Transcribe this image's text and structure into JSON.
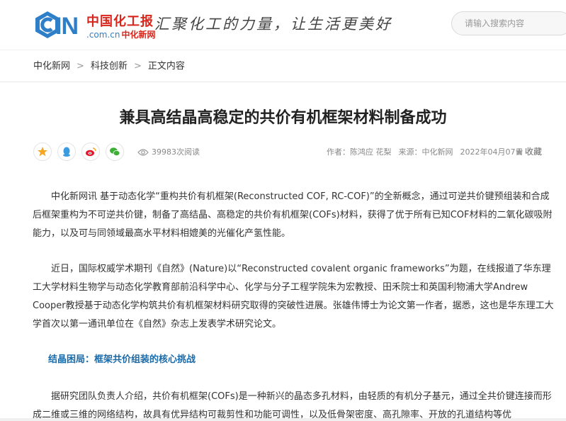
{
  "header": {
    "logo": {
      "cin": "IN",
      "cn_name": "中国化工报",
      "domain": ".com.cn",
      "site_name": "中化新网"
    },
    "slogan": "汇聚化工的力量，让生活更美好",
    "search": {
      "placeholder": "请输入搜索内容",
      "value": ""
    }
  },
  "breadcrumb": {
    "items": [
      "中化新网",
      "科技创新",
      "正文内容"
    ],
    "separator": ">"
  },
  "article": {
    "title": "兼具高结晶高稳定的共价有机框架材料制备成功",
    "share_icons": [
      "star-icon",
      "qq-icon",
      "weibo-icon",
      "wechat-icon"
    ],
    "views": "39983次阅读",
    "author": "作者：陈鸿应 花梨",
    "source": "来源：中化新网",
    "date": "2022年04月07日",
    "favorite": "收藏",
    "paragraphs": [
      "中化新网讯 基于动态化学“重构共价有机框架(Reconstructed COF, RC-COF)”的全新概念，通过可逆共价键预组装和合成后框架重构为不可逆共价键，制备了高结晶、高稳定的共价有机框架(COFs)材料，获得了优于所有已知COF材料的二氧化碳吸附能力，以及可与同领域最高水平材料相媲美的光催化产氢性能。",
      "近日，国际权威学术期刊《自然》(Nature)以“Reconstructed covalent organic frameworks”为题，在线报道了华东理工大学材料生物学与动态化学教育部前沿科学中心、化学与分子工程学院朱为宏教授、田禾院士和英国利物浦大学Andrew Cooper教授基于动态化学构筑共价有机框架材料研究取得的突破性进展。张雄伟博士为论文第一作者，据悉，这也是华东理工大学首次以第一通讯单位在《自然》杂志上发表学术研究论文。"
    ],
    "subheading": "结晶困局：框架共价组装的核心挑战",
    "paragraph3": "据研究团队负责人介绍，共价有机框架(COFs)是一种新兴的晶态多孔材料，由轻质的有机分子基元，通过全共价键连接而形成二维或三维的网络结构，故具有优异结构可裁剪性和功能可调性，以及低骨架密度、高孔隙率、开放的孔道结构等优"
  },
  "colors": {
    "brand_blue": "#2e7ec8",
    "brand_red": "#d8261c",
    "subheading": "#1a6aa8"
  }
}
